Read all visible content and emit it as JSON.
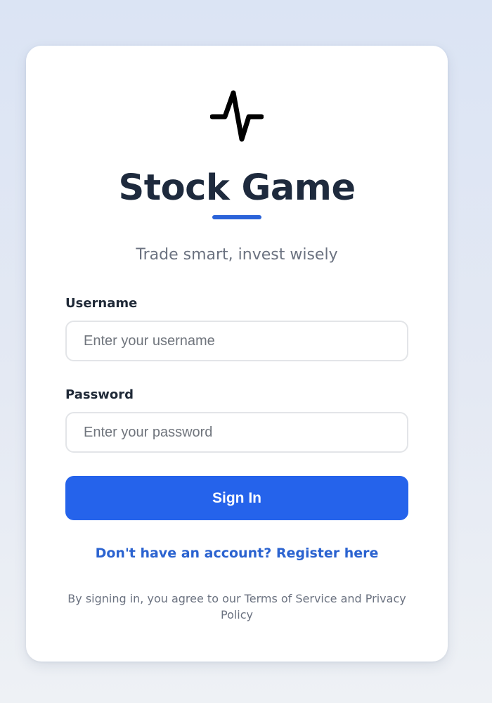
{
  "app": {
    "logo_icon": "pulse-line-icon",
    "title": "Stock Game",
    "subtitle": "Trade smart, invest wisely",
    "accent_color": "#2563eb"
  },
  "form": {
    "username": {
      "label": "Username",
      "value": "",
      "placeholder": "Enter your username"
    },
    "password": {
      "label": "Password",
      "value": "",
      "placeholder": "Enter your password"
    },
    "submit_label": "Sign In"
  },
  "register_link": "Don't have an account? Register here",
  "terms_text": "By signing in, you agree to our Terms of Service and Privacy Policy"
}
